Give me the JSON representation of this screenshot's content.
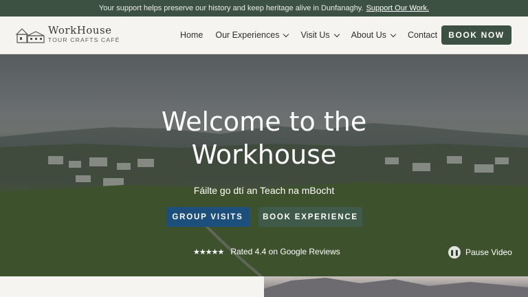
{
  "announcement": {
    "text": "Your support helps preserve our history and keep heritage alive in Dunfanaghy.",
    "link": "Support Our Work."
  },
  "logo": {
    "title": "WorkHouse",
    "subtitle": "TOUR CRAFTS CAFÉ"
  },
  "nav": {
    "items": [
      {
        "label": "Home",
        "dropdown": false
      },
      {
        "label": "Our Experiences",
        "dropdown": true
      },
      {
        "label": "Visit Us",
        "dropdown": true
      },
      {
        "label": "About Us",
        "dropdown": true
      },
      {
        "label": "Contact",
        "dropdown": false
      }
    ],
    "book_label": "BOOK NOW"
  },
  "hero": {
    "title_line1": "Welcome to the",
    "title_line2": "Workhouse",
    "subtitle": "Fáilte go dtí an Teach na mBocht",
    "group_button": "GROUP VISITS",
    "experience_button": "BOOK EXPERIENCE",
    "stars": "★★★★★",
    "rating_text": "Rated 4.4 on Google Reviews",
    "pause_label": "Pause Video"
  },
  "colors": {
    "brand_green": "#3d5142",
    "group_blue": "#1d4f7c"
  }
}
